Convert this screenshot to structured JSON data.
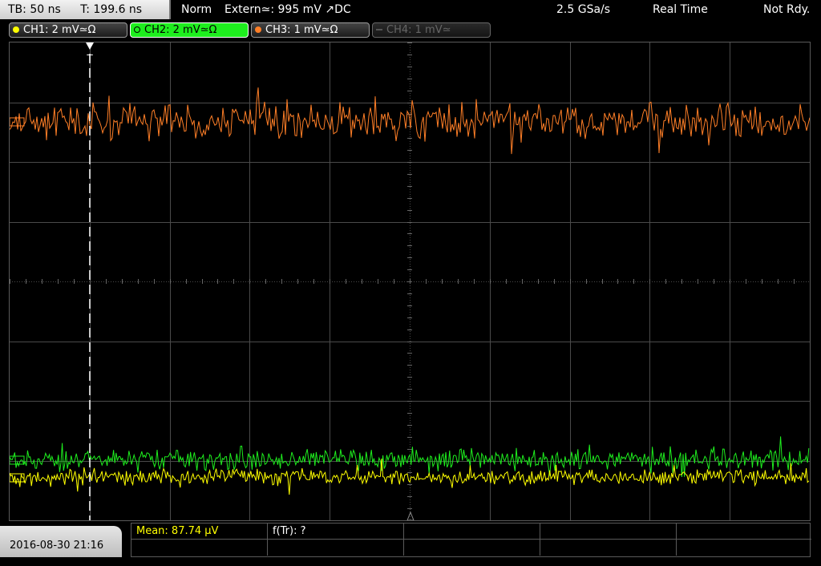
{
  "header": {
    "timebase": "TB: 50 ns",
    "trigger_time": "T: 199.6 ns",
    "trigger_mode": "Norm",
    "trigger_source": "Extern≃: 995 mV ↗DC",
    "sample_rate": "2.5 GSa/s",
    "acq_mode": "Real Time",
    "status": "Not Rdy."
  },
  "channels": [
    {
      "label": "CH1: 2 mV≃Ω",
      "color": "#ffff00",
      "active": false,
      "enabled": true
    },
    {
      "label": "CH2: 2 mV≃Ω",
      "color": "#1eee1e",
      "active": true,
      "enabled": true
    },
    {
      "label": "CH3: 1 mV≃Ω",
      "color": "#ff7f27",
      "active": false,
      "enabled": true
    },
    {
      "label": "CH4: 1 mV≃",
      "color": "#666666",
      "active": false,
      "enabled": false
    }
  ],
  "trigger_marker": "T",
  "footer": {
    "datetime": "2016-08-30 21:16",
    "mean": "Mean: 87.74 µV",
    "frequency": "f(Tr): ?"
  },
  "colors": {
    "ch1": "#ffff00",
    "ch2": "#1eee1e",
    "ch3": "#ff7f27",
    "grid": "#4a4a4a",
    "measure_text": "#ffff00"
  }
}
